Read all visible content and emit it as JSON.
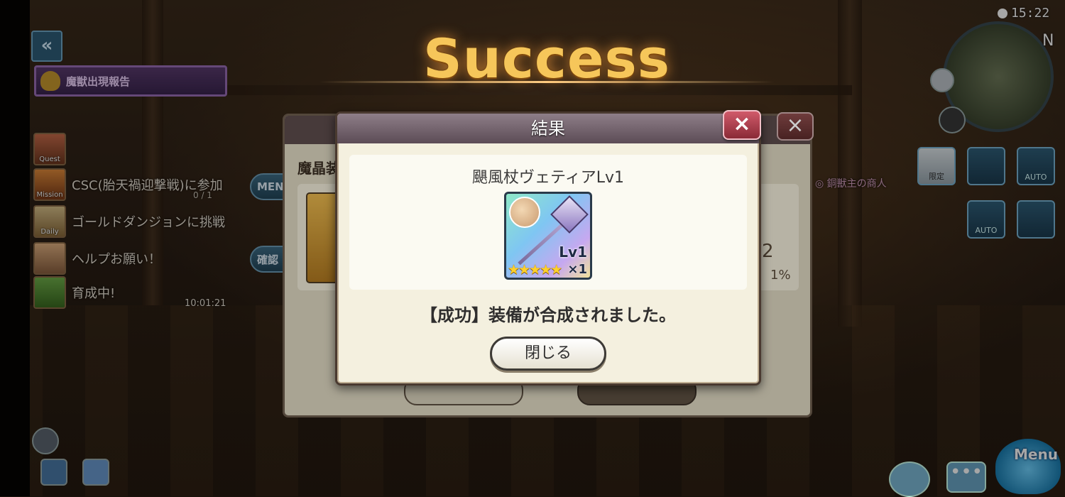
{
  "hud": {
    "clock": "15:22",
    "minimap_direction": "N",
    "notice_banner": "魔獣出現報告",
    "quests": [
      {
        "icon_label": "Quest",
        "text": ""
      },
      {
        "icon_label": "Mission",
        "text": "CSC(胎天禍迎撃戦)に参加",
        "progress": "0 / 1"
      },
      {
        "icon_label": "Daily",
        "text": "ゴールドダンジョンに挑戦"
      },
      {
        "icon_label": "",
        "text": "ヘルプお願い！"
      },
      {
        "icon_label": "",
        "text": "育成中!"
      }
    ],
    "timer": "10:01:21",
    "side_buttons": [
      "MEN",
      "確認"
    ],
    "right_buttons": [
      "限定",
      "",
      "AUTO",
      "AUTO",
      ""
    ],
    "npc_label": "◎ 銅獣主の商人",
    "menu_label": "Menu",
    "chat_glyph": "•••"
  },
  "title": "Success",
  "back_dialog": {
    "subtitle": "魔晶装",
    "number": "2",
    "percent": "1%"
  },
  "result_dialog": {
    "header": "結果",
    "close_icon": "×",
    "item": {
      "name": "颶風杖ヴェティアLv1",
      "level": "Lv1",
      "count": "×1",
      "stars": "★★★★★",
      "star_count": 5
    },
    "message": "【成功】装備が合成されました。",
    "close_button": "閉じる"
  },
  "colors": {
    "title_gold": "#f6c65a",
    "dialog_bg": "#f4f0df",
    "header_bg": "#5c4c56",
    "close_red": "#d05a6a"
  }
}
